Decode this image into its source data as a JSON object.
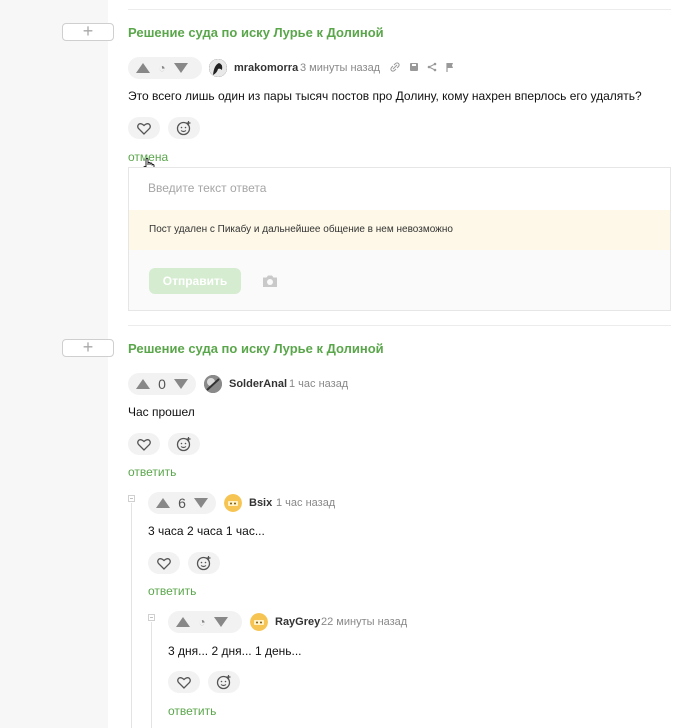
{
  "plus_label": "+",
  "comments": [
    {
      "story_title": "Решение суда по иску Лурье к Долиной",
      "user": "mrakomorra",
      "time": "3 минуты назад",
      "text": "Это всего лишь один из пары тысяч постов про Долину, кому нахрен вперлось его удалять?",
      "link_label": "отмена"
    },
    {
      "story_title": "Решение суда по иску Лурье к Долиной",
      "rating": "0",
      "user": "SolderAnal",
      "time": "1 час назад",
      "text": "Час прошел",
      "link_label": "ответить"
    },
    {
      "rating": "6",
      "user": "Bsix",
      "time": "1 час назад",
      "text": "3 часа 2 часа 1 час...",
      "link_label": "ответить"
    },
    {
      "user": "RayGrey",
      "time": "22 минуты назад",
      "text": "3 дня... 2 дня... 1 день...",
      "link_label": "ответить"
    }
  ],
  "reply_form": {
    "placeholder": "Введите текст ответа",
    "notice": "Пост удален с Пикабу и дальнейшее общение в нем невозможно",
    "submit_label": "Отправить"
  },
  "icons": {
    "like": "heart-icon",
    "emoji": "emoji-add-icon",
    "camera": "camera-icon",
    "link": "link-icon",
    "save": "save-icon",
    "share": "share-icon",
    "report": "flag-icon"
  },
  "colors": {
    "accent": "#5aa64b",
    "notice_bg": "#fdf8e7",
    "submit_bg": "#d5ecd0"
  }
}
